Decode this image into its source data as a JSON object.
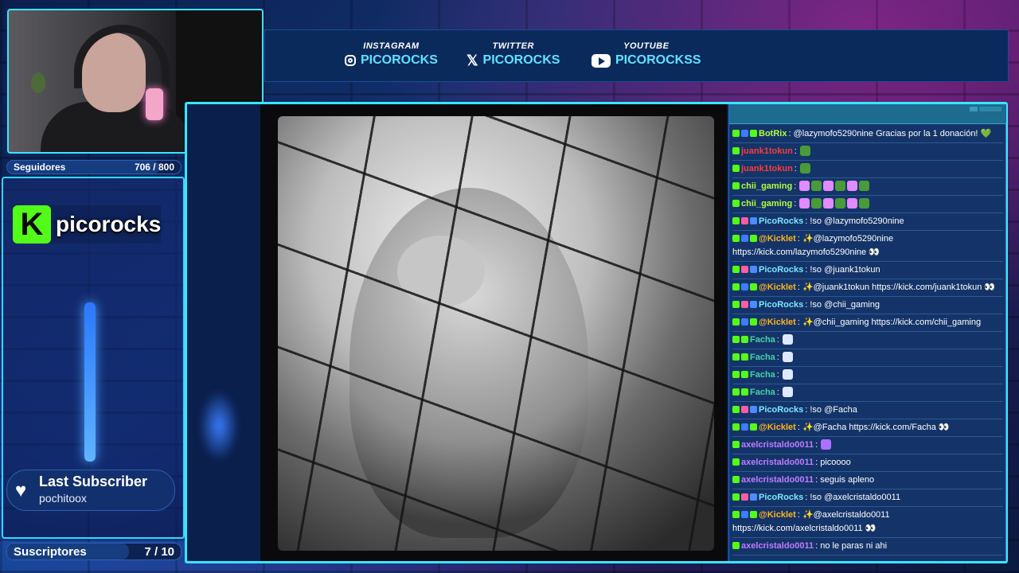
{
  "stats": {
    "followers_label": "Seguidores",
    "followers_value": "706 / 800",
    "followers_progress": 0.8825,
    "subscribers_label": "Suscriptores",
    "subscribers_value": "7 / 10",
    "subscribers_progress": 0.7
  },
  "brand": {
    "logo_letter": "K",
    "channel_name": "picorocks",
    "accent": "#53fc18"
  },
  "last_sub": {
    "title": "Last Subscriber",
    "name": "pochitoox"
  },
  "socials": [
    {
      "label": "INSTAGRAM",
      "handle": "PICOROCKS",
      "icon": "instagram-icon"
    },
    {
      "label": "TWITTER",
      "handle": "PICOROCKS",
      "icon": "x-icon"
    },
    {
      "label": "YOUTUBE",
      "handle": "PICOROCKSS",
      "icon": "youtube-icon"
    }
  ],
  "chat": [
    {
      "user": "BotRix",
      "cls": "u-botrix",
      "badges": [
        "kick",
        "mod",
        "ver"
      ],
      "text": "@lazymofo5290nine Gracias por la 1 donación! 💚"
    },
    {
      "user": "juank1tokun",
      "cls": "u-juank",
      "badges": [
        "kick"
      ],
      "emotes": [
        "pepe"
      ]
    },
    {
      "user": "juank1tokun",
      "cls": "u-juank",
      "badges": [
        "kick"
      ],
      "emotes": [
        "pepe"
      ]
    },
    {
      "user": "chii_gaming",
      "cls": "u-chii",
      "badges": [
        "kick"
      ],
      "emotes": [
        "w",
        "pepe",
        "w",
        "pepe",
        "w",
        "pepe"
      ]
    },
    {
      "user": "chii_gaming",
      "cls": "u-chii",
      "badges": [
        "kick"
      ],
      "emotes": [
        "w",
        "pepe",
        "w",
        "pepe",
        "w",
        "pepe"
      ]
    },
    {
      "user": "PicoRocks",
      "cls": "u-pico",
      "badges": [
        "kick",
        "pink",
        "bot"
      ],
      "text": "!so @lazymofo5290nine"
    },
    {
      "user": "@Kicklet",
      "cls": "u-kicklet",
      "badges": [
        "kick",
        "mod",
        "ver"
      ],
      "text": "✨@lazymofo5290nine https://kick.com/lazymofo5290nine 👀"
    },
    {
      "user": "PicoRocks",
      "cls": "u-pico",
      "badges": [
        "kick",
        "pink",
        "bot"
      ],
      "text": "!so @juank1tokun"
    },
    {
      "user": "@Kicklet",
      "cls": "u-kicklet",
      "badges": [
        "kick",
        "mod",
        "ver"
      ],
      "text": "✨@juank1tokun https://kick.com/juank1tokun 👀"
    },
    {
      "user": "PicoRocks",
      "cls": "u-pico",
      "badges": [
        "kick",
        "pink",
        "bot"
      ],
      "text": "!so @chii_gaming"
    },
    {
      "user": "@Kicklet",
      "cls": "u-kicklet",
      "badges": [
        "kick",
        "mod",
        "ver"
      ],
      "text": "✨@chii_gaming https://kick.com/chii_gaming"
    },
    {
      "user": "Facha",
      "cls": "u-facha",
      "badges": [
        "kick",
        "ver"
      ],
      "emotes": [
        "cup"
      ]
    },
    {
      "user": "Facha",
      "cls": "u-facha",
      "badges": [
        "kick",
        "ver"
      ],
      "emotes": [
        "cup"
      ]
    },
    {
      "user": "Facha",
      "cls": "u-facha",
      "badges": [
        "kick",
        "ver"
      ],
      "emotes": [
        "cup"
      ]
    },
    {
      "user": "Facha",
      "cls": "u-facha",
      "badges": [
        "kick",
        "ver"
      ],
      "emotes": [
        "cup"
      ]
    },
    {
      "user": "PicoRocks",
      "cls": "u-pico",
      "badges": [
        "kick",
        "pink",
        "bot"
      ],
      "text": "!so @Facha"
    },
    {
      "user": "@Kicklet",
      "cls": "u-kicklet",
      "badges": [
        "kick",
        "mod",
        "ver"
      ],
      "text": "✨@Facha https://kick.com/Facha 👀"
    },
    {
      "user": "axelcristaldo0011",
      "cls": "u-axel",
      "badges": [
        "kick"
      ],
      "emotes": [
        "cat"
      ]
    },
    {
      "user": "axelcristaldo0011",
      "cls": "u-axel",
      "badges": [
        "kick"
      ],
      "text": "picoooo"
    },
    {
      "user": "axelcristaldo0011",
      "cls": "u-axel",
      "badges": [
        "kick"
      ],
      "text": "seguis apleno"
    },
    {
      "user": "PicoRocks",
      "cls": "u-pico",
      "badges": [
        "kick",
        "pink",
        "bot"
      ],
      "text": "!so @axelcristaldo0011"
    },
    {
      "user": "@Kicklet",
      "cls": "u-kicklet",
      "badges": [
        "kick",
        "mod",
        "ver"
      ],
      "text": "✨@axelcristaldo0011 https://kick.com/axelcristaldo0011 👀"
    },
    {
      "user": "axelcristaldo0011",
      "cls": "u-axel",
      "badges": [
        "kick"
      ],
      "text": "no le paras ni ahi"
    }
  ]
}
